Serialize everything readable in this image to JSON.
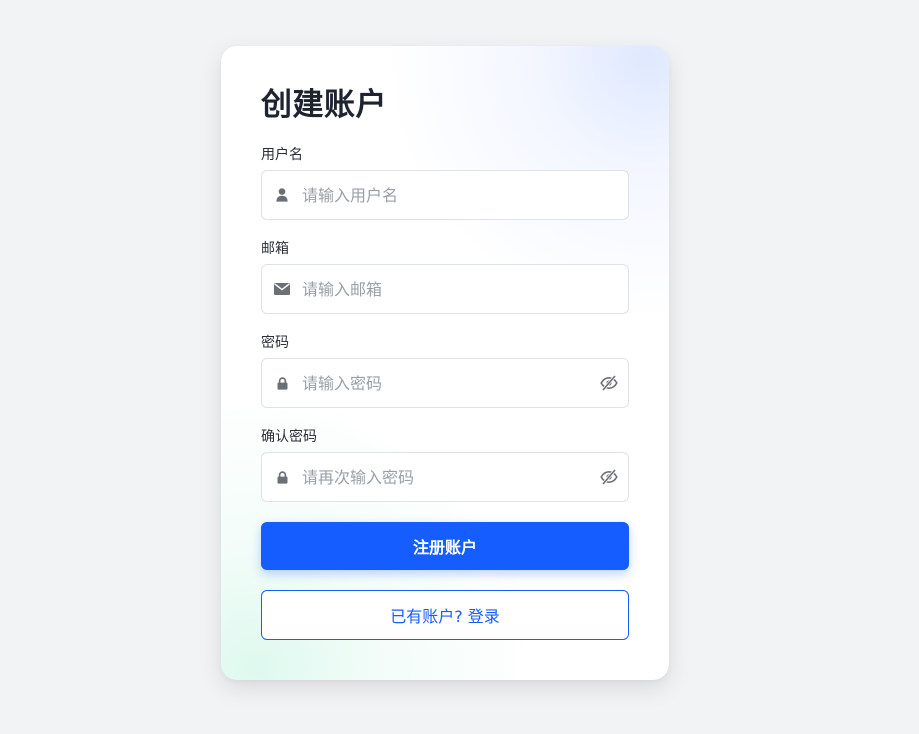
{
  "form": {
    "title": "创建账户",
    "fields": [
      {
        "label": "用户名",
        "placeholder": "请输入用户名",
        "value": "",
        "icon": "user-icon"
      },
      {
        "label": "邮箱",
        "placeholder": "请输入邮箱",
        "value": "",
        "icon": "envelope-icon"
      },
      {
        "label": "密码",
        "placeholder": "请输入密码",
        "value": "",
        "icon": "lock-icon",
        "toggle_icon": "eye-slash-icon"
      },
      {
        "label": "确认密码",
        "placeholder": "请再次输入密码",
        "value": "",
        "icon": "lock-icon",
        "toggle_icon": "eye-slash-icon"
      }
    ],
    "submit_label": "注册账户",
    "login_label": "已有账户? 登录"
  },
  "colors": {
    "primary": "#165dff",
    "page_background": "#f2f3f5",
    "title_text": "#1d2430",
    "icon_gray": "#6b6f76",
    "placeholder": "#9aa0a8",
    "input_border": "#dfe2e7"
  }
}
